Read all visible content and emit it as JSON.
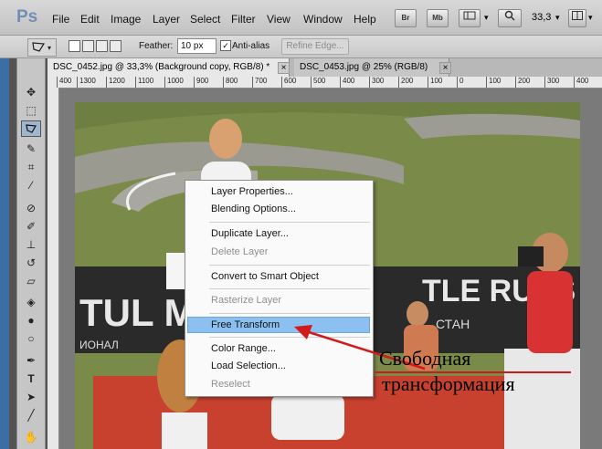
{
  "app": {
    "logo": "Ps"
  },
  "menubar": {
    "items": [
      "File",
      "Edit",
      "Image",
      "Layer",
      "Select",
      "Filter",
      "View",
      "Window",
      "Help"
    ],
    "buttons": [
      "Br",
      "Mb"
    ],
    "zoom": "33,3"
  },
  "options": {
    "feather_label": "Feather:",
    "feather_value": "10 px",
    "antialias_label": "Anti-alias",
    "refine_label": "Refine Edge..."
  },
  "tabs": [
    {
      "label": "DSC_0452.jpg @ 33,3% (Background copy, RGB/8) *"
    },
    {
      "label": "DSC_0453.jpg @ 25% (RGB/8)"
    }
  ],
  "ruler": {
    "ticks": [
      "400",
      "1300",
      "1200",
      "1100",
      "1000",
      "900",
      "800",
      "700",
      "600",
      "500",
      "400",
      "300",
      "200",
      "100",
      "0",
      "100",
      "200",
      "300",
      "400"
    ]
  },
  "context_menu": {
    "items": [
      {
        "label": "Layer Properties...",
        "disabled": false
      },
      {
        "label": "Blending Options...",
        "disabled": false
      },
      {
        "label": "Duplicate Layer...",
        "disabled": false
      },
      {
        "label": "Delete Layer",
        "disabled": true
      },
      {
        "label": "Convert to Smart Object",
        "disabled": false
      },
      {
        "label": "Rasterize Layer",
        "disabled": true
      },
      {
        "label": "Free Transform",
        "disabled": false,
        "highlighted": true
      },
      {
        "label": "Color Range...",
        "disabled": false
      },
      {
        "label": "Load Selection...",
        "disabled": false
      },
      {
        "label": "Reselect",
        "disabled": true
      }
    ]
  },
  "annotation": {
    "line1": "Свободная",
    "line2": "трансформация",
    "color": "#d11a1a"
  },
  "banner": {
    "left_text": "TUL M",
    "right_text": "TLE RUSS",
    "bottom_left": "ИОНАЛ",
    "bottom_right": "СТАН"
  },
  "colors": {
    "highlight": "#8cc0f0",
    "arrow": "#d11a1a"
  }
}
